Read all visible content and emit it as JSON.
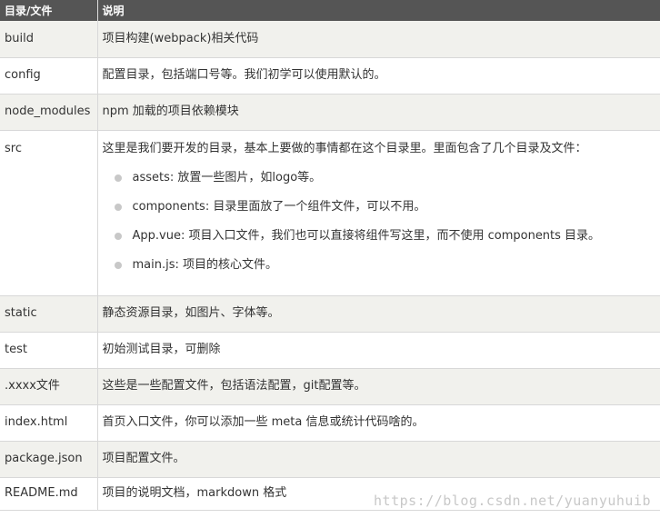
{
  "table": {
    "headers": [
      "目录/文件",
      "说明"
    ],
    "rows": [
      {
        "name": "build",
        "desc": "项目构建(webpack)相关代码"
      },
      {
        "name": "config",
        "desc": "配置目录，包括端口号等。我们初学可以使用默认的。"
      },
      {
        "name": "node_modules",
        "desc": "npm 加载的项目依赖模块"
      },
      {
        "name": "src",
        "desc": "这里是我们要开发的目录，基本上要做的事情都在这个目录里。里面包含了几个目录及文件：",
        "items": [
          "assets: 放置一些图片，如logo等。",
          "components: 目录里面放了一个组件文件，可以不用。",
          "App.vue: 项目入口文件，我们也可以直接将组件写这里，而不使用 components 目录。",
          "main.js: 项目的核心文件。"
        ]
      },
      {
        "name": "static",
        "desc": "静态资源目录，如图片、字体等。"
      },
      {
        "name": "test",
        "desc": "初始测试目录，可删除"
      },
      {
        "name": ".xxxx文件",
        "desc": "这些是一些配置文件，包括语法配置，git配置等。"
      },
      {
        "name": "index.html",
        "desc": "首页入口文件，你可以添加一些 meta 信息或统计代码啥的。"
      },
      {
        "name": "package.json",
        "desc": "项目配置文件。"
      },
      {
        "name": "README.md",
        "desc": "项目的说明文档，markdown 格式"
      }
    ]
  },
  "watermark": "https://blog.csdn.net/yuanyuhuib"
}
